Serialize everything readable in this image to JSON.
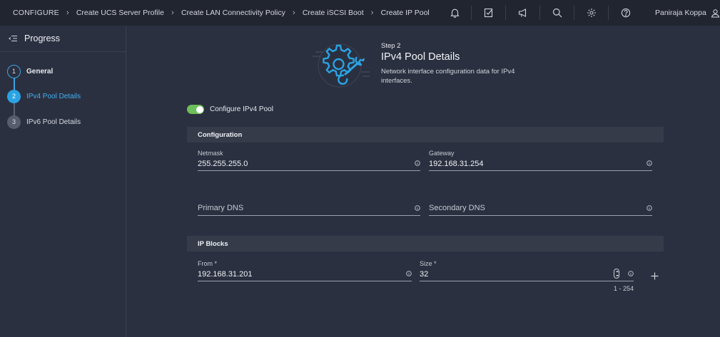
{
  "breadcrumbs": [
    "CONFIGURE",
    "Create UCS Server Profile",
    "Create LAN Connectivity Policy",
    "Create iSCSI Boot",
    "Create IP Pool"
  ],
  "topbar": {
    "icons": [
      "bell-icon",
      "task-check-icon",
      "megaphone-icon",
      "search-icon",
      "gear-icon",
      "help-icon"
    ],
    "user_name": "Paniraja Koppa"
  },
  "sidebar": {
    "title": "Progress",
    "steps": [
      {
        "number": "1",
        "label": "General",
        "state": "completed"
      },
      {
        "number": "2",
        "label": "IPv4 Pool Details",
        "state": "active"
      },
      {
        "number": "3",
        "label": "IPv6 Pool Details",
        "state": "pending"
      }
    ]
  },
  "header": {
    "step": "Step 2",
    "title": "IPv4 Pool Details",
    "description": "Network interface configuration data for IPv4 interfaces."
  },
  "toggle": {
    "label": "Configure IPv4 Pool",
    "on": true
  },
  "configuration": {
    "title": "Configuration",
    "netmask": {
      "label": "Netmask",
      "value": "255.255.255.0"
    },
    "gateway": {
      "label": "Gateway",
      "value": "192.168.31.254"
    },
    "primary_dns": {
      "placeholder": "Primary DNS"
    },
    "secondary_dns": {
      "placeholder": "Secondary DNS"
    }
  },
  "ip_blocks": {
    "title": "IP Blocks",
    "from": {
      "label": "From *",
      "value": "192.168.31.201"
    },
    "size": {
      "label": "Size *",
      "value": "32",
      "range": "1 - 254"
    }
  },
  "colors": {
    "accent": "#2aa3e3",
    "toggle_on": "#6cbf5a",
    "background": "#2b3040",
    "topbar": "#21252f"
  }
}
